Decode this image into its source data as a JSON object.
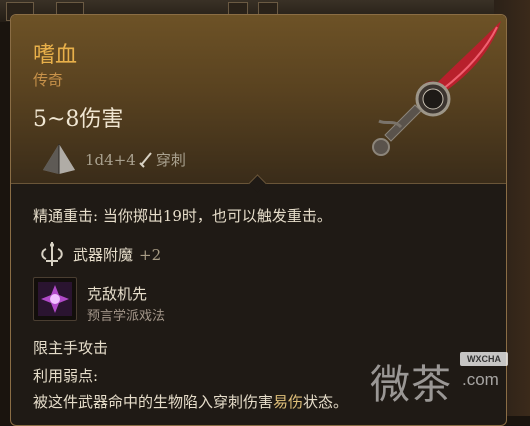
{
  "item": {
    "name": "嗜血",
    "rarity": "传奇",
    "damage": "5~8伤害",
    "dice": "1d4+4",
    "damage_type": "穿刺",
    "rarity_color": "#e8b04a"
  },
  "effects": {
    "weapon_action": "精通重击: 当你掷出19时，也可以触发重击。",
    "enchant_label": "武器附魔",
    "enchant_value": "+2",
    "spell_name": "克敌机先",
    "spell_school": "预言学派戏法",
    "main_hand": "限主手攻击",
    "weakness_title": "利用弱点:",
    "weakness_desc_prefix": "被这件武器命中的生物陷入穿刺伤害",
    "weakness_keyword": "易伤",
    "weakness_desc_suffix": "状态。"
  },
  "watermark": {
    "text": "微茶",
    "badge": "WXCHA",
    "domain": ".com"
  },
  "icons": {
    "die": "d4-die-icon",
    "dagger": "piercing-dagger-icon",
    "enchant": "weapon-enchant-icon",
    "spell": "spell-rune-icon"
  }
}
